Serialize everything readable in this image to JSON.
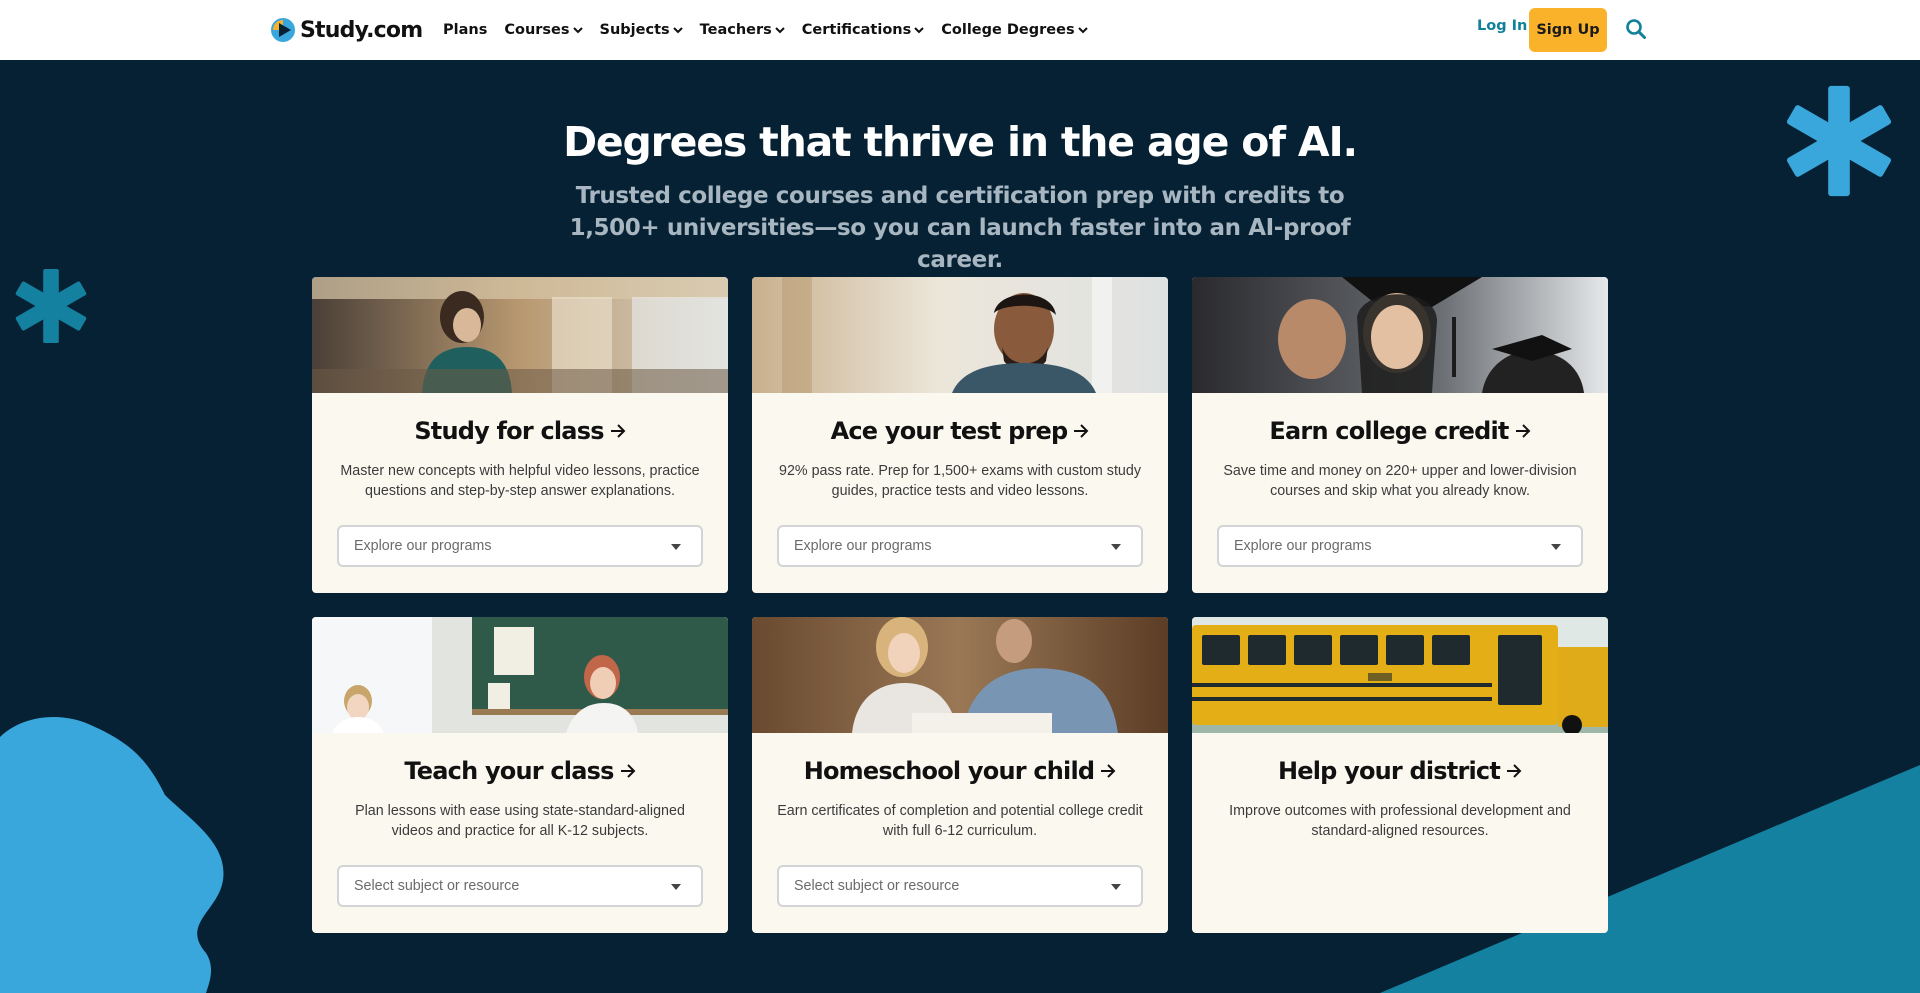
{
  "nav": {
    "logo_text": "Study.com",
    "links": [
      {
        "label": "Plans"
      },
      {
        "label": "Courses"
      },
      {
        "label": "Subjects"
      },
      {
        "label": "Teachers"
      },
      {
        "label": "Certifications"
      },
      {
        "label": "College Degrees"
      }
    ],
    "login_label": "Log In",
    "signup_label": "Sign Up"
  },
  "hero": {
    "title": "Degrees that thrive in the age of AI.",
    "subtitle": "Trusted college courses and certification prep with credits to 1,500+ universities—so you can launch faster into an AI-proof career."
  },
  "cards": [
    {
      "title": "Study for class",
      "description": "Master new concepts with helpful video lessons, practice questions and step-by-step answer explanations.",
      "select_placeholder": "Explore our programs"
    },
    {
      "title": "Ace your test prep",
      "description": "92% pass rate. Prep for 1,500+ exams with custom study guides, practice tests and video lessons.",
      "select_placeholder": "Explore our programs"
    },
    {
      "title": "Earn college credit",
      "description": "Save time and money on 220+ upper and lower-division courses and skip what you already know.",
      "select_placeholder": "Explore our programs"
    },
    {
      "title": "Teach your class",
      "description": "Plan lessons with ease using state-standard-aligned videos and practice for all K-12 subjects.",
      "select_placeholder": "Select subject or resource"
    },
    {
      "title": "Homeschool your child",
      "description": "Earn certificates of completion and potential college credit with full 6-12 curriculum.",
      "select_placeholder": "Select subject or resource"
    },
    {
      "title": "Help your district",
      "description": "Improve outcomes with professional development and standard-aligned resources."
    }
  ],
  "colors": {
    "background": "#062133",
    "accent_blue": "#3aa7dc",
    "teal_dark": "#13819f",
    "signup": "#fbb22b",
    "login": "#10819a",
    "card_bg": "#fbf9ef"
  }
}
